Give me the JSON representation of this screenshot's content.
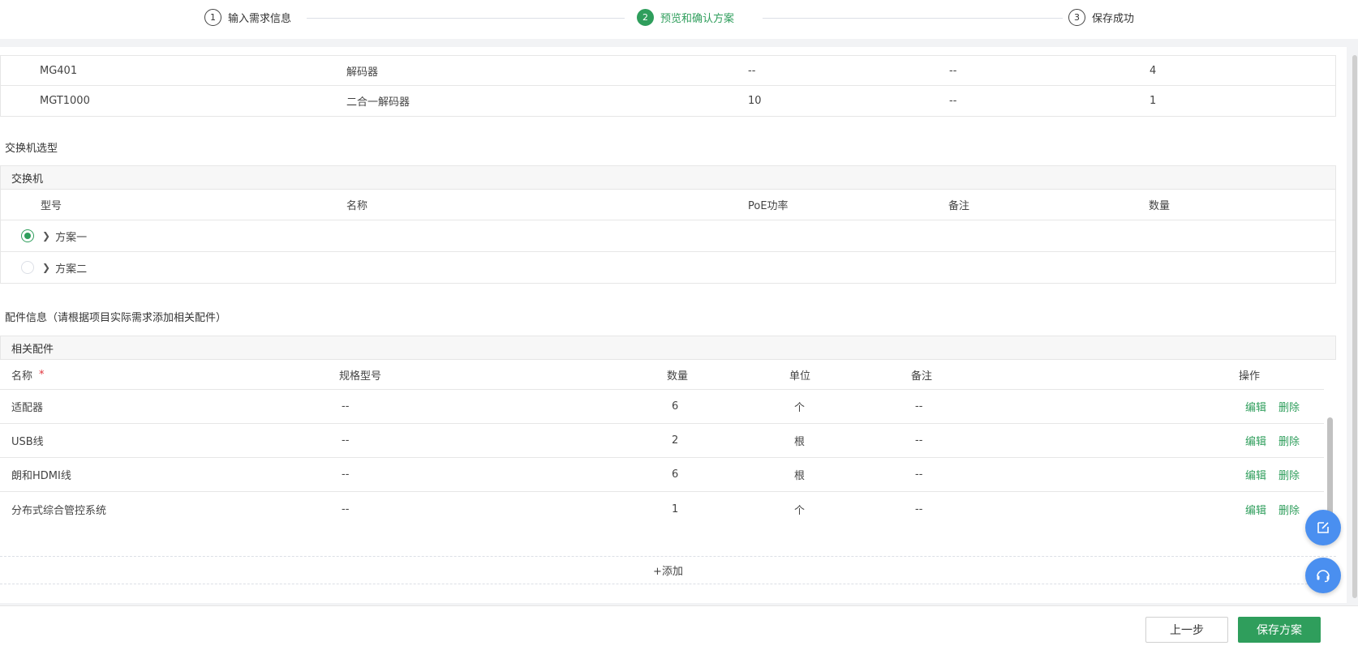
{
  "steps": [
    {
      "num": "1",
      "label": "输入需求信息",
      "active": false
    },
    {
      "num": "2",
      "label": "预览和确认方案",
      "active": true
    },
    {
      "num": "3",
      "label": "保存成功",
      "active": false
    }
  ],
  "decoder_rows": [
    {
      "model": "MG401",
      "name": "解码器",
      "poe": "--",
      "remark": "--",
      "qty": "4"
    },
    {
      "model": "MGT1000",
      "name": "二合一解码器",
      "poe": "10",
      "remark": "--",
      "qty": "1"
    }
  ],
  "switch_section": {
    "title": "交换机选型",
    "group": "交换机",
    "headers": {
      "model": "型号",
      "name": "名称",
      "poe": "PoE功率",
      "remark": "备注",
      "qty": "数量"
    },
    "options": [
      {
        "label": "方案一",
        "selected": true
      },
      {
        "label": "方案二",
        "selected": false
      }
    ]
  },
  "accessory_section": {
    "title": "配件信息（请根据项目实际需求添加相关配件）",
    "group": "相关配件",
    "headers": {
      "name": "名称",
      "required_mark": "*",
      "spec": "规格型号",
      "qty": "数量",
      "unit": "单位",
      "remark": "备注",
      "action": "操作"
    },
    "rows": [
      {
        "name": "适配器",
        "spec": "--",
        "qty": "6",
        "unit": "个",
        "remark": "--"
      },
      {
        "name": "USB线",
        "spec": "--",
        "qty": "2",
        "unit": "根",
        "remark": "--"
      },
      {
        "name": "朗和HDMI线",
        "spec": "--",
        "qty": "6",
        "unit": "根",
        "remark": "--"
      },
      {
        "name": "分布式综合管控系统",
        "spec": "--",
        "qty": "1",
        "unit": "个",
        "remark": "--"
      }
    ],
    "edit_label": "编辑",
    "delete_label": "删除",
    "add_label": "+添加"
  },
  "footer": {
    "prev_label": "上一步",
    "save_label": "保存方案"
  },
  "colors": {
    "accent": "#2f9e5c",
    "fab": "#4a8ff0",
    "required": "#e0323b"
  },
  "fab_icons": [
    "edit-icon",
    "headset-icon"
  ]
}
